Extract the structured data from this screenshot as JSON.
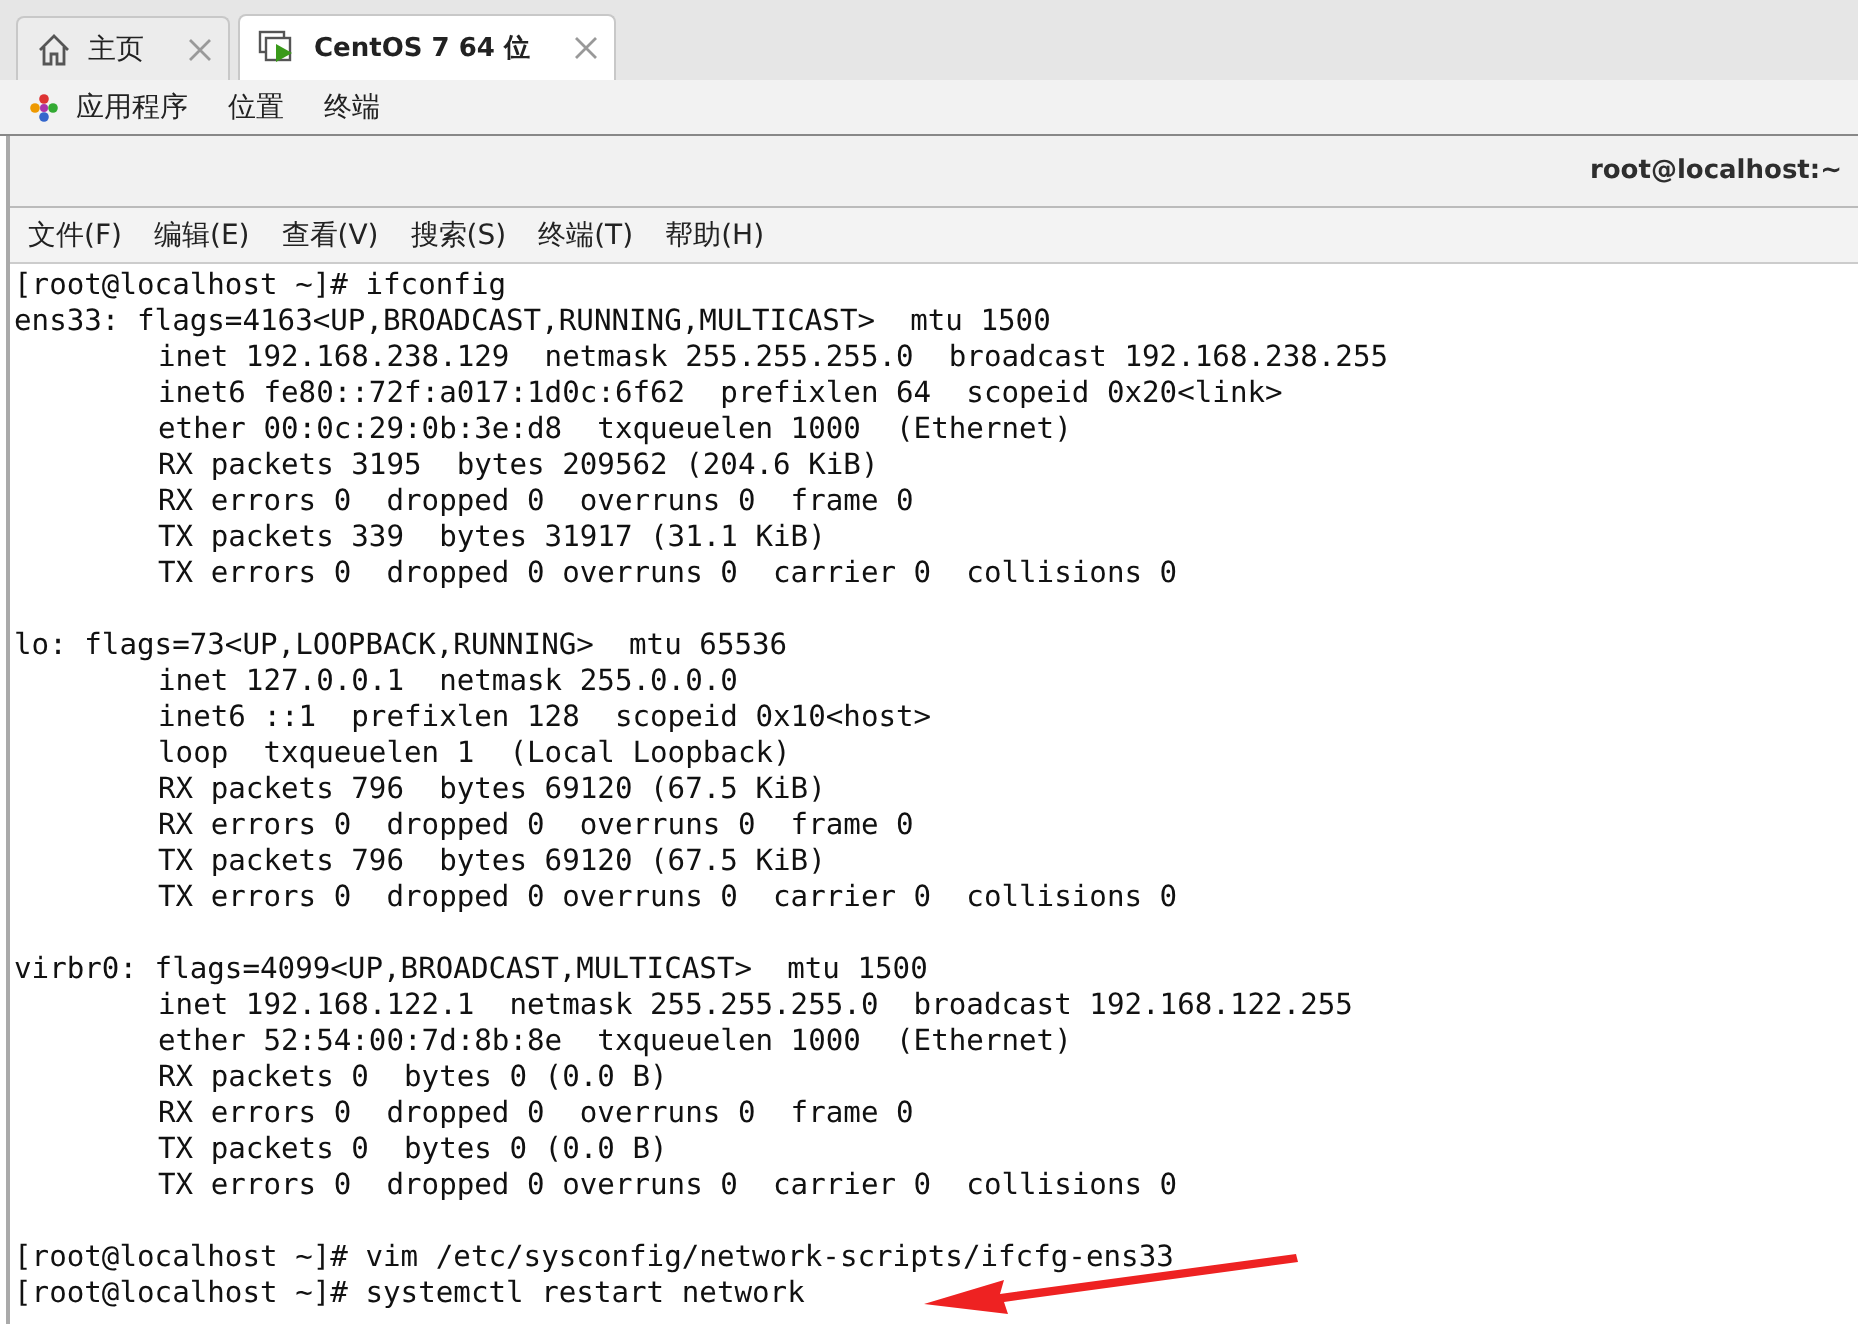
{
  "tabs": [
    {
      "label": "主页",
      "kind": "home",
      "selected": false
    },
    {
      "label": "CentOS 7 64 位",
      "kind": "vm",
      "selected": true
    }
  ],
  "desktop_menu": [
    {
      "label": "应用程序",
      "kind": "apps"
    },
    {
      "label": "位置",
      "kind": "plain"
    },
    {
      "label": "终端",
      "kind": "plain"
    }
  ],
  "window": {
    "title": "root@localhost:~"
  },
  "menu_bar": [
    "文件(F)",
    "编辑(E)",
    "查看(V)",
    "搜索(S)",
    "终端(T)",
    "帮助(H)"
  ],
  "terminal": {
    "entries": [
      {
        "kind": "prompt",
        "text": "[root@localhost ~]# ifconfig"
      },
      {
        "kind": "interface",
        "header": "ens33: flags=4163<UP,BROADCAST,RUNNING,MULTICAST>  mtu 1500",
        "details": [
          "inet 192.168.238.129  netmask 255.255.255.0  broadcast 192.168.238.255",
          "inet6 fe80::72f:a017:1d0c:6f62  prefixlen 64  scopeid 0x20<link>",
          "ether 00:0c:29:0b:3e:d8  txqueuelen 1000  (Ethernet)",
          "RX packets 3195  bytes 209562 (204.6 KiB)",
          "RX errors 0  dropped 0  overruns 0  frame 0",
          "TX packets 339  bytes 31917 (31.1 KiB)",
          "TX errors 0  dropped 0 overruns 0  carrier 0  collisions 0"
        ]
      },
      {
        "kind": "interface",
        "header": "lo: flags=73<UP,LOOPBACK,RUNNING>  mtu 65536",
        "details": [
          "inet 127.0.0.1  netmask 255.0.0.0",
          "inet6 ::1  prefixlen 128  scopeid 0x10<host>",
          "loop  txqueuelen 1  (Local Loopback)",
          "RX packets 796  bytes 69120 (67.5 KiB)",
          "RX errors 0  dropped 0  overruns 0  frame 0",
          "TX packets 796  bytes 69120 (67.5 KiB)",
          "TX errors 0  dropped 0 overruns 0  carrier 0  collisions 0"
        ]
      },
      {
        "kind": "interface",
        "header": "virbr0: flags=4099<UP,BROADCAST,MULTICAST>  mtu 1500",
        "details": [
          "inet 192.168.122.1  netmask 255.255.255.0  broadcast 192.168.122.255",
          "ether 52:54:00:7d:8b:8e  txqueuelen 1000  (Ethernet)",
          "RX packets 0  bytes 0 (0.0 B)",
          "RX errors 0  dropped 0  overruns 0  frame 0",
          "TX packets 0  bytes 0 (0.0 B)",
          "TX errors 0  dropped 0 overruns 0  carrier 0  collisions 0"
        ]
      },
      {
        "kind": "prompt",
        "text": "[root@localhost ~]# vim /etc/sysconfig/network-scripts/ifcfg-ens33"
      },
      {
        "kind": "prompt",
        "text": "[root@localhost ~]# systemctl restart network"
      }
    ]
  },
  "annotations": [
    {
      "kind": "arrow",
      "color": "#ee2222"
    }
  ]
}
